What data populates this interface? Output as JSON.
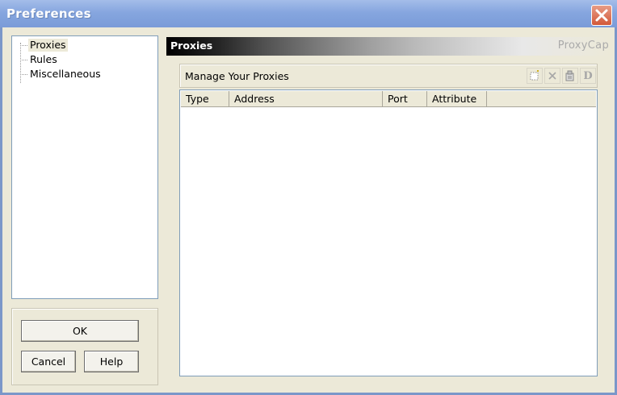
{
  "window": {
    "title": "Preferences"
  },
  "tree": {
    "items": [
      "Proxies",
      "Rules",
      "Miscellaneous"
    ]
  },
  "buttons": {
    "ok": "OK",
    "cancel": "Cancel",
    "help": "Help"
  },
  "panel": {
    "banner": "Proxies",
    "brand": "ProxyCap",
    "group_title": "Manage Your Proxies",
    "toolbar": {
      "d_label": "D"
    }
  },
  "table": {
    "columns": [
      "Type",
      "Address",
      "Port",
      "Attribute"
    ]
  }
}
